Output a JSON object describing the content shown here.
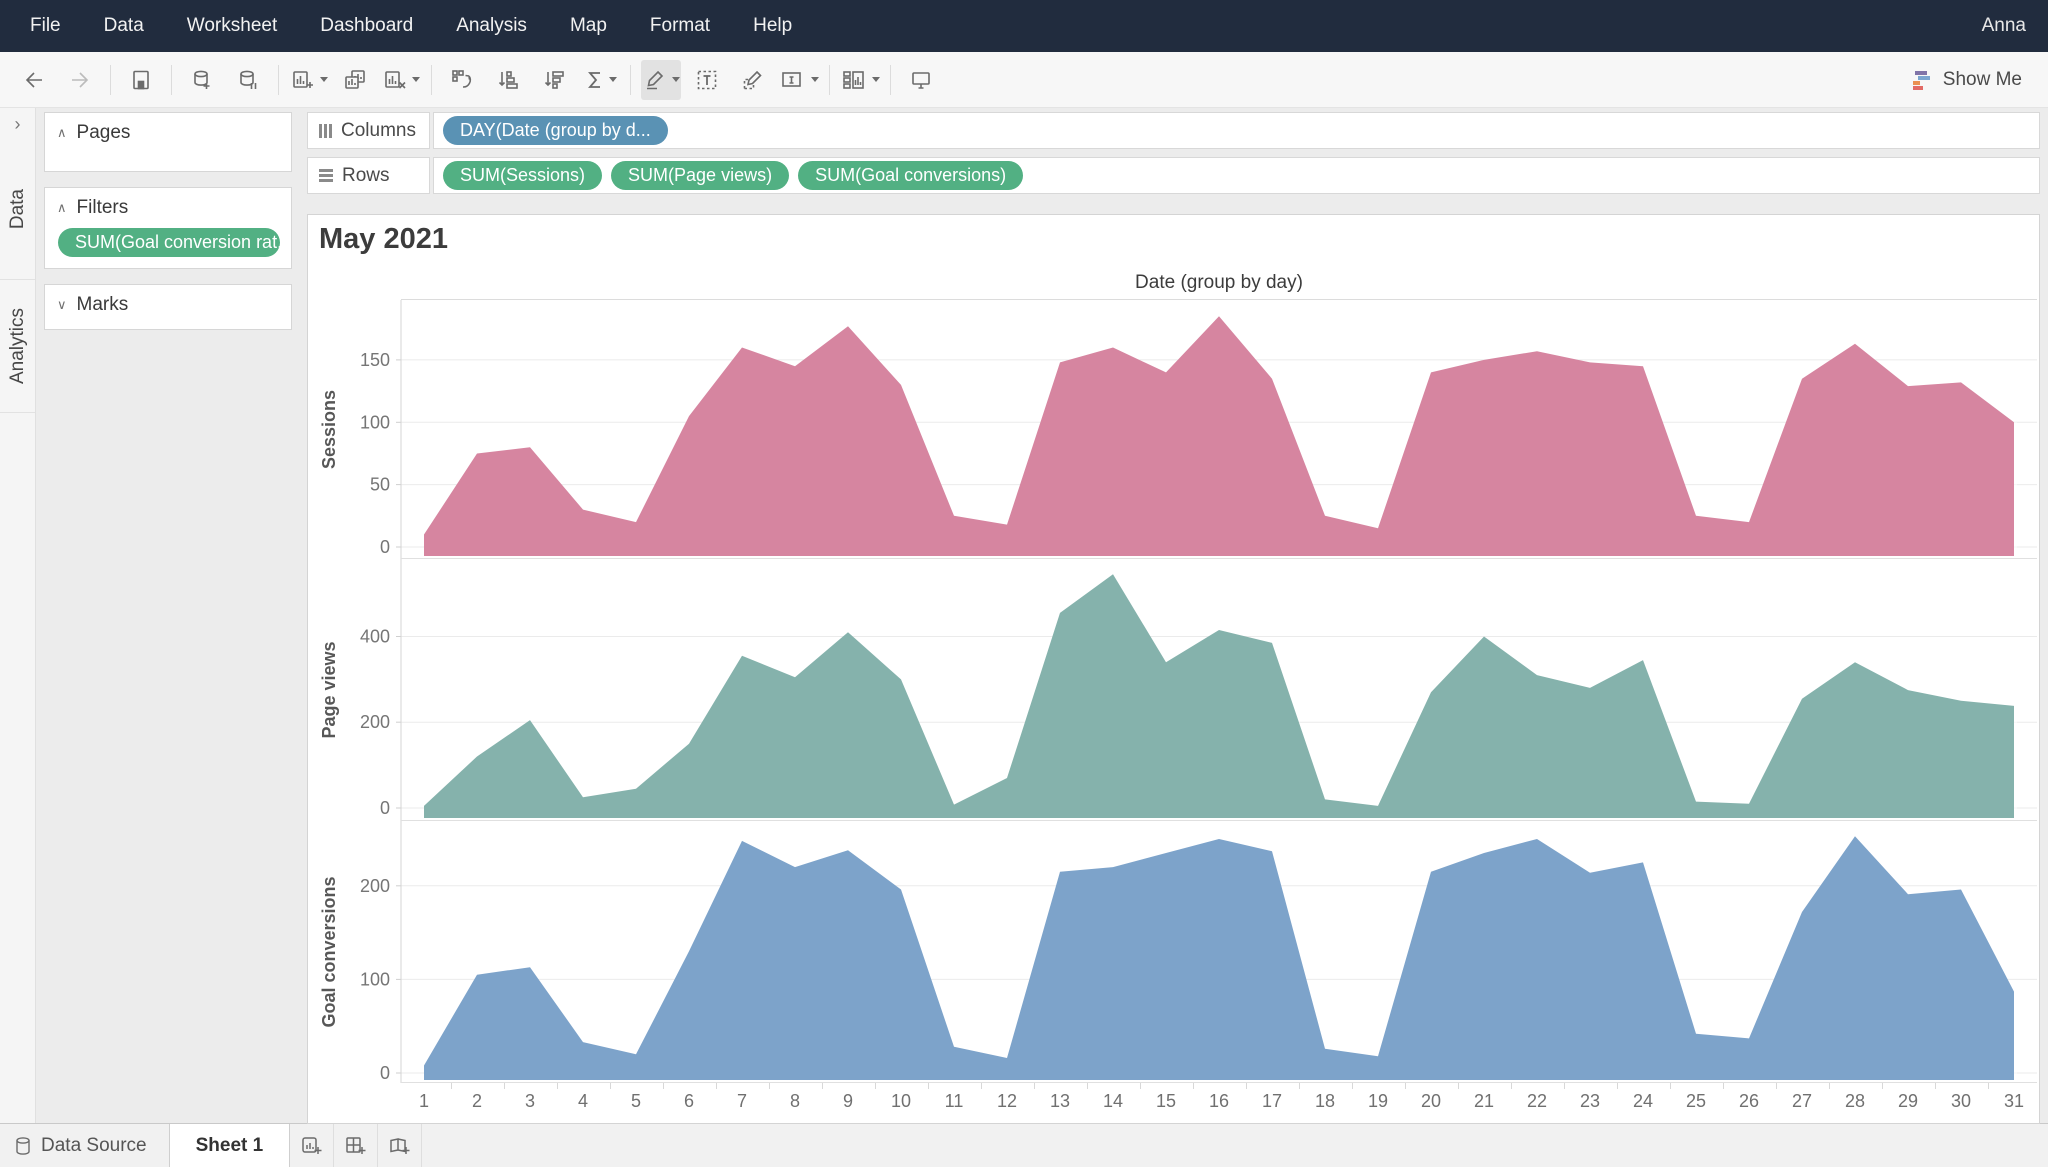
{
  "menu": {
    "items": [
      "File",
      "Data",
      "Worksheet",
      "Dashboard",
      "Analysis",
      "Map",
      "Format",
      "Help"
    ],
    "user": "Anna"
  },
  "toolbar": {
    "show_me_label": "Show Me",
    "icons": [
      "back-icon",
      "forward-icon",
      "save-icon",
      "new-datasource-icon",
      "pause-updates-icon",
      "new-worksheet-icon",
      "duplicate-sheet-icon",
      "clear-sheet-icon",
      "swap-axes-icon",
      "sort-ascending-icon",
      "sort-descending-icon",
      "totals-icon",
      "highlight-icon",
      "show-mark-labels-icon",
      "format-icon",
      "fit-icon",
      "show-hide-cards-icon",
      "presentation-mode-icon"
    ],
    "show_me_icon_colors": [
      "#8074a8",
      "#7ba6d0",
      "#eb9152",
      "#e26b66"
    ]
  },
  "left_tabs": {
    "data": "Data",
    "analytics": "Analytics"
  },
  "sidebar": {
    "pages_title": "Pages",
    "filters_title": "Filters",
    "filter_pill": {
      "label": "SUM(Goal conversion rat...",
      "color": "#52b083"
    },
    "marks_title": "Marks"
  },
  "shelves": {
    "columns_label": "Columns",
    "columns_pill": {
      "label": "DAY(Date (group by d...",
      "color": "#5a92b4"
    },
    "rows_label": "Rows",
    "rows_pill_color": "#52b083",
    "rows_pills": [
      "SUM(Sessions)",
      "SUM(Page views)",
      "SUM(Goal conversions)"
    ]
  },
  "viz": {
    "title": "May 2021",
    "column_header": "Date (group by day)"
  },
  "chart_data": {
    "type": "area",
    "title": "May 2021",
    "xlabel": "Date (group by day)",
    "x": [
      1,
      2,
      3,
      4,
      5,
      6,
      7,
      8,
      9,
      10,
      11,
      12,
      13,
      14,
      15,
      16,
      17,
      18,
      19,
      20,
      21,
      22,
      23,
      24,
      25,
      26,
      27,
      28,
      29,
      30,
      31
    ],
    "grid": true,
    "series": [
      {
        "name": "Sessions",
        "color": "#d685a0",
        "yticks": [
          0,
          50,
          100,
          150
        ],
        "ylim": [
          0,
          200
        ],
        "values": [
          10,
          75,
          80,
          30,
          20,
          105,
          160,
          145,
          177,
          130,
          25,
          18,
          148,
          160,
          140,
          185,
          135,
          25,
          15,
          140,
          150,
          157,
          148,
          145,
          25,
          20,
          135,
          163,
          129,
          132,
          100
        ]
      },
      {
        "name": "Page views",
        "color": "#85b2ac",
        "yticks": [
          0,
          200,
          400
        ],
        "ylim": [
          0,
          575
        ],
        "values": [
          5,
          120,
          205,
          25,
          45,
          150,
          355,
          305,
          410,
          300,
          8,
          70,
          455,
          545,
          340,
          415,
          385,
          20,
          5,
          270,
          400,
          310,
          280,
          345,
          15,
          10,
          255,
          340,
          275,
          250,
          238
        ]
      },
      {
        "name": "Goal conversions",
        "color": "#7da3ca",
        "yticks": [
          0,
          100,
          200
        ],
        "ylim": [
          0,
          270
        ],
        "values": [
          8,
          105,
          113,
          33,
          20,
          130,
          248,
          220,
          238,
          196,
          28,
          16,
          215,
          220,
          235,
          250,
          237,
          26,
          18,
          215,
          235,
          250,
          214,
          225,
          42,
          37,
          172,
          253,
          191,
          196,
          87
        ]
      }
    ]
  },
  "statusbar": {
    "data_source_label": "Data Source",
    "sheet_label": "Sheet 1"
  }
}
